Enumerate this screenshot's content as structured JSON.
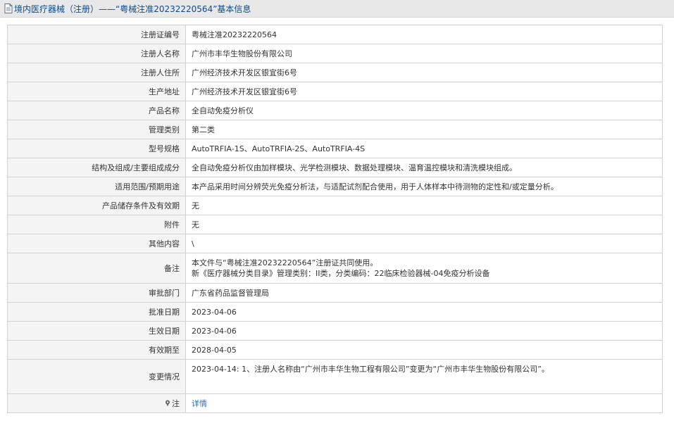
{
  "page": {
    "title": "境内医疗器械（注册）——“粤械注准20232220564”基本信息"
  },
  "rows": [
    {
      "label": "注册证编号",
      "value": "粤械注准20232220564"
    },
    {
      "label": "注册人名称",
      "value": "广州市丰华生物股份有限公司"
    },
    {
      "label": "注册人住所",
      "value": "广州经济技术开发区银宜街6号"
    },
    {
      "label": "生产地址",
      "value": "广州经济技术开发区银宜街6号"
    },
    {
      "label": "产品名称",
      "value": "全自动免疫分析仪"
    },
    {
      "label": "管理类别",
      "value": "第二类"
    },
    {
      "label": "型号规格",
      "value": "AutoTRFIA-1S、AutoTRFIA-2S、AutoTRFIA-4S"
    },
    {
      "label": "结构及组成/主要组成成分",
      "value": "全自动免疫分析仪由加样模块、光学检测模块、数据处理模块、温育温控模块和清洗模块组成。"
    },
    {
      "label": "适用范围/预期用途",
      "value": "本产品采用时间分辨荧光免疫分析法，与适配试剂配合使用，用于人体样本中待测物的定性和/或定量分析。"
    },
    {
      "label": "产品储存条件及有效期",
      "value": "无"
    },
    {
      "label": "附件",
      "value": "无"
    },
    {
      "label": "其他内容",
      "value": "\\"
    },
    {
      "label": "备注",
      "value_line1": "本文件与“粤械注准20232220564”注册证共同使用。",
      "value_line2": "新《医疗器械分类目录》管理类别：II类，分类编码：22临床检验器械-04免疫分析设备"
    },
    {
      "label": "审批部门",
      "value": "广东省药品监督管理局"
    },
    {
      "label": "批准日期",
      "value": "2023-04-06"
    },
    {
      "label": "生效日期",
      "value": "2023-04-06"
    },
    {
      "label": "有效期至",
      "value": "2028-04-05"
    },
    {
      "label": "变更情况",
      "value": "2023-04-14: 1、注册人名称由“广州市丰华生物工程有限公司”变更为“广州市丰华生物股份有限公司”。"
    },
    {
      "label": "注",
      "value": "详情",
      "icon": "pin-icon"
    }
  ],
  "colors": {
    "title": "#0a4a8a",
    "link": "#2a6bb3",
    "label_bg": "#f4f4f4",
    "border": "#d2d2d2"
  }
}
